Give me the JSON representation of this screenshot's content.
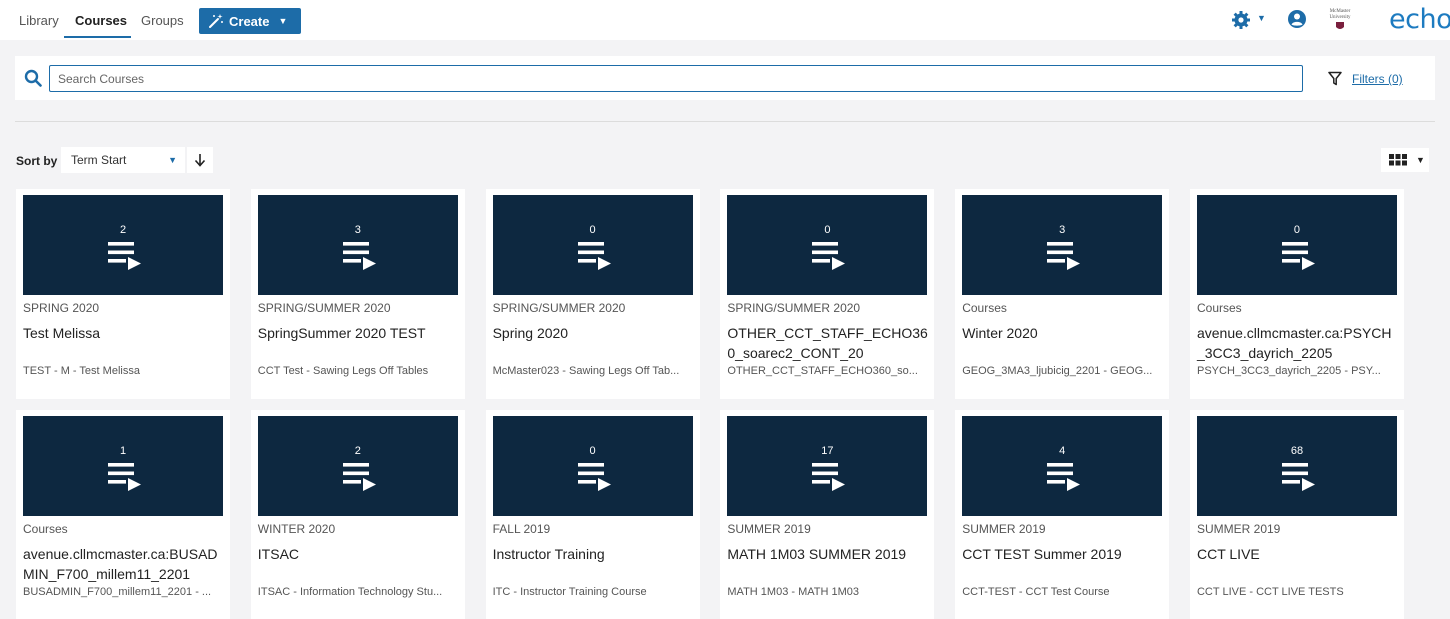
{
  "nav": {
    "tabs": [
      "Library",
      "Courses",
      "Groups"
    ],
    "active_tab": "Courses",
    "create_label": "Create",
    "institution_logo_text": "McMaster University",
    "brand_logo_text": "echo"
  },
  "search": {
    "placeholder": "Search Courses",
    "value": "",
    "filters_label": "Filters (0)"
  },
  "sort": {
    "label": "Sort by",
    "selected": "Term Start"
  },
  "colors": {
    "accent": "#1d6ca8",
    "thumbnail_bg": "#0d2840",
    "page_bg": "#f3f3f5"
  },
  "courses": [
    {
      "count": "2",
      "term": "SPRING 2020",
      "title": "Test Melissa",
      "subtitle": "TEST - M - Test Melissa"
    },
    {
      "count": "3",
      "term": "SPRING/SUMMER 2020",
      "title": "SpringSummer 2020 TEST",
      "subtitle": "CCT Test - Sawing Legs Off Tables"
    },
    {
      "count": "0",
      "term": "SPRING/SUMMER 2020",
      "title": "Spring 2020",
      "subtitle": "McMaster023 - Sawing Legs Off Tab..."
    },
    {
      "count": "0",
      "term": "SPRING/SUMMER 2020",
      "title": "OTHER_CCT_STAFF_ECHO360_soarec2_CONT_20",
      "subtitle": "OTHER_CCT_STAFF_ECHO360_so..."
    },
    {
      "count": "3",
      "term": "Courses",
      "title": "Winter 2020",
      "subtitle": "GEOG_3MA3_ljubicig_2201 - GEOG..."
    },
    {
      "count": "0",
      "term": "Courses",
      "title": "avenue.cllmcmaster.ca:PSYCH_3CC3_dayrich_2205",
      "subtitle": "PSYCH_3CC3_dayrich_2205 - PSY..."
    },
    {
      "count": "1",
      "term": "Courses",
      "title": "avenue.cllmcmaster.ca:BUSADMIN_F700_millem11_2201",
      "subtitle": "BUSADMIN_F700_millem11_2201 - ..."
    },
    {
      "count": "2",
      "term": "WINTER 2020",
      "title": "ITSAC",
      "subtitle": "ITSAC - Information Technology Stu..."
    },
    {
      "count": "0",
      "term": "FALL 2019",
      "title": "Instructor Training",
      "subtitle": "ITC - Instructor Training Course"
    },
    {
      "count": "17",
      "term": "SUMMER 2019",
      "title": "MATH 1M03 SUMMER 2019",
      "subtitle": "MATH 1M03 - MATH 1M03"
    },
    {
      "count": "4",
      "term": "SUMMER 2019",
      "title": "CCT TEST Summer 2019",
      "subtitle": "CCT-TEST - CCT Test Course"
    },
    {
      "count": "68",
      "term": "SUMMER 2019",
      "title": "CCT LIVE",
      "subtitle": "CCT LIVE - CCT LIVE TESTS"
    }
  ]
}
